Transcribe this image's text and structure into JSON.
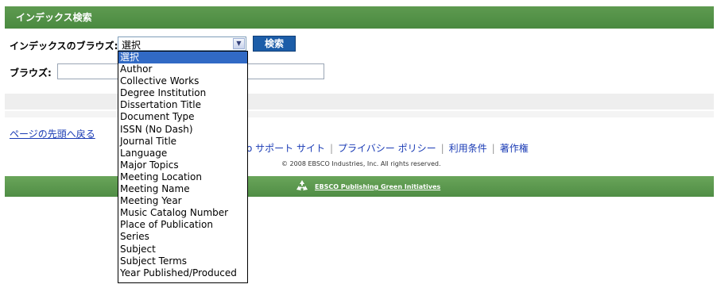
{
  "header": {
    "title": "インデックス検索"
  },
  "browse_index": {
    "label": "インデックスのブラウズ:",
    "selected_value": "選択",
    "options": [
      "選択",
      "Author",
      "Collective Works",
      "Degree Institution",
      "Dissertation Title",
      "Document Type",
      "ISSN (No Dash)",
      "Journal Title",
      "Language",
      "Major Topics",
      "Meeting Location",
      "Meeting Name",
      "Meeting Year",
      "Music Catalog Number",
      "Place of Publication",
      "Series",
      "Subject",
      "Subject Terms",
      "Year Published/Produced"
    ],
    "highlighted_index": 0
  },
  "search_button": {
    "label": "検索"
  },
  "browse_input": {
    "label": "ブラウズ:",
    "value": ""
  },
  "top_link": {
    "label": "ページの先頭へ戻る"
  },
  "footer": {
    "links": [
      "o サポート サイト",
      "プライバシー ポリシー",
      "利用条件",
      "著作権"
    ],
    "copyright": "© 2008 EBSCO Industries, Inc. All rights reserved.",
    "green_initiative": "EBSCO Publishing Green Initiatives"
  },
  "colors": {
    "header_green": "#4a8a40",
    "button_blue": "#1c5da8",
    "selection_blue": "#316ac5",
    "link_blue": "#1a3bb5"
  },
  "icons": {
    "green_initiative": "recycle-icon",
    "select_arrow": "chevron-down-icon"
  }
}
